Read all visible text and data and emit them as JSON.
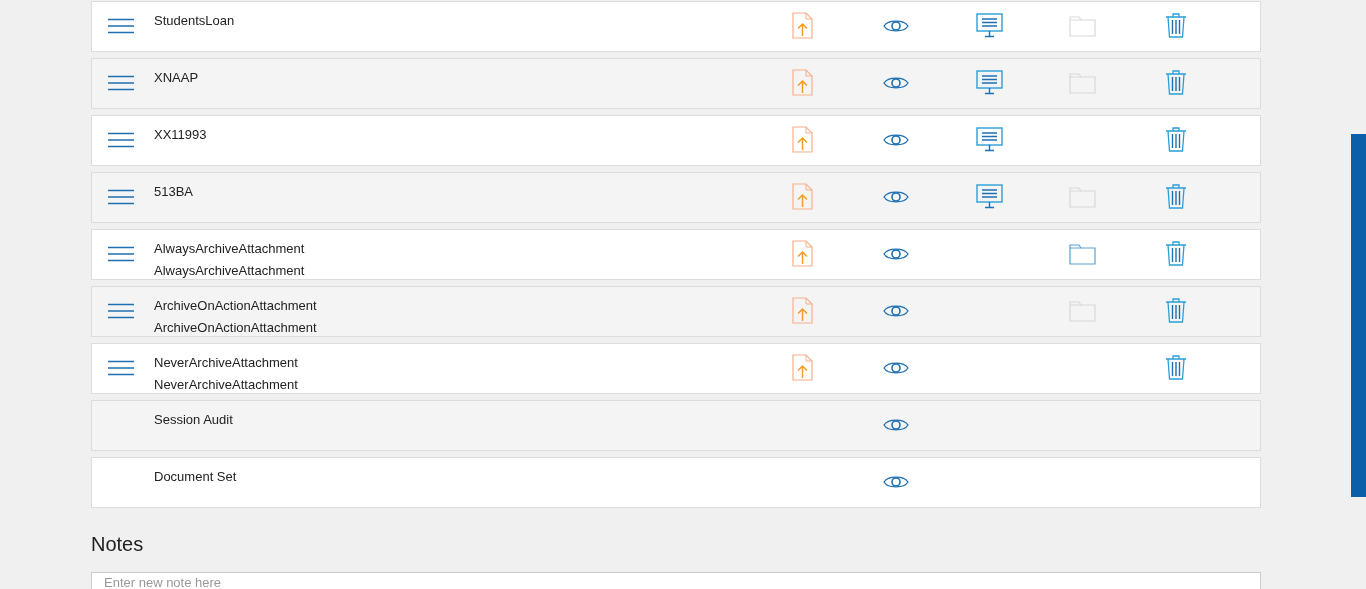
{
  "rows": [
    {
      "lines": [
        "StudentsLoan"
      ],
      "reorder": true,
      "upload": true,
      "view": true,
      "display": true,
      "folder": true,
      "folder_disabled": true,
      "delete": true
    },
    {
      "lines": [
        "XNAAP"
      ],
      "reorder": true,
      "upload": true,
      "view": true,
      "display": true,
      "folder": true,
      "folder_disabled": true,
      "delete": true
    },
    {
      "lines": [
        "XX11993"
      ],
      "reorder": true,
      "upload": true,
      "view": true,
      "display": true,
      "folder": false,
      "delete": true
    },
    {
      "lines": [
        "513BA"
      ],
      "reorder": true,
      "upload": true,
      "view": true,
      "display": true,
      "folder": true,
      "folder_disabled": true,
      "delete": true
    },
    {
      "lines": [
        "AlwaysArchiveAttachment",
        "AlwaysArchiveAttachment"
      ],
      "reorder": true,
      "upload": true,
      "view": true,
      "display": false,
      "folder": true,
      "folder_disabled": false,
      "delete": true
    },
    {
      "lines": [
        "ArchiveOnActionAttachment",
        "ArchiveOnActionAttachment"
      ],
      "reorder": true,
      "upload": true,
      "view": true,
      "display": false,
      "folder": true,
      "folder_disabled": true,
      "delete": true
    },
    {
      "lines": [
        "NeverArchiveAttachment",
        "NeverArchiveAttachment"
      ],
      "reorder": true,
      "upload": true,
      "view": true,
      "display": false,
      "folder": false,
      "delete": true
    },
    {
      "lines": [
        "Session Audit"
      ],
      "reorder": false,
      "upload": false,
      "view": true,
      "display": false,
      "folder": false,
      "delete": false
    },
    {
      "lines": [
        "Document Set"
      ],
      "reorder": false,
      "upload": false,
      "view": true,
      "display": false,
      "folder": false,
      "delete": false
    }
  ],
  "notes": {
    "title": "Notes",
    "placeholder": "Enter new note here"
  }
}
